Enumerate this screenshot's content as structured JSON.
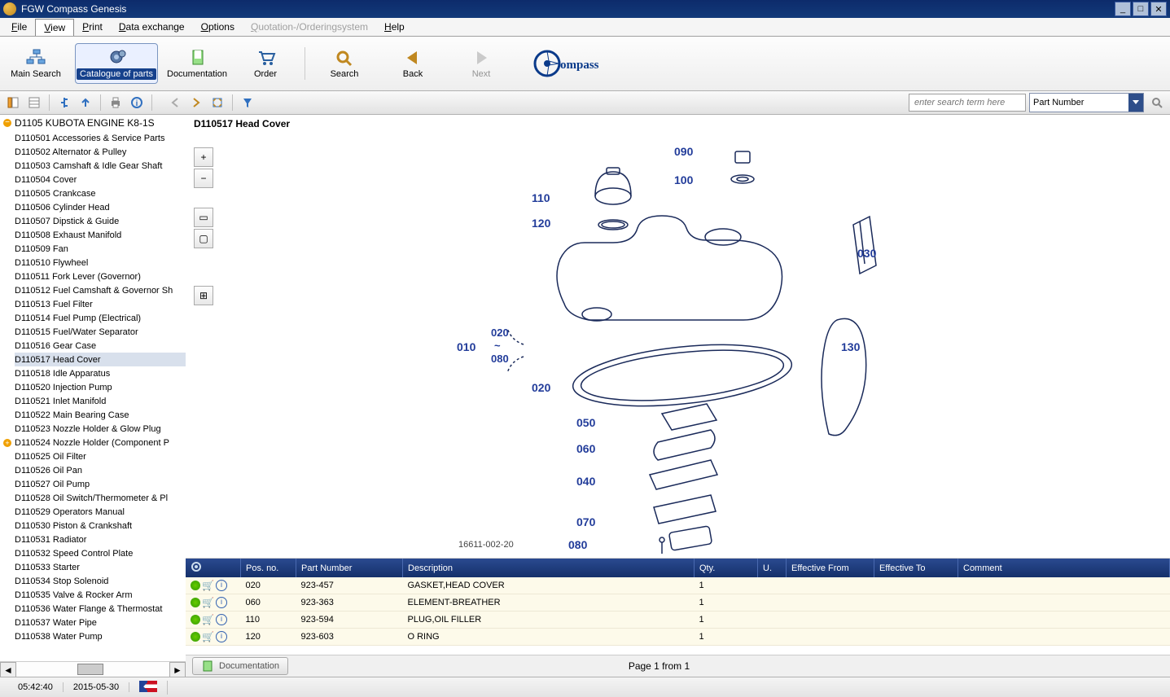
{
  "window": {
    "title": "FGW Compass Genesis"
  },
  "menubar": {
    "items": [
      {
        "label": "File",
        "disabled": false
      },
      {
        "label": "View",
        "disabled": false,
        "open": true
      },
      {
        "label": "Print",
        "disabled": false
      },
      {
        "label": "Data exchange",
        "disabled": false
      },
      {
        "label": "Options",
        "disabled": false
      },
      {
        "label": "Quotation-/Orderingsystem",
        "disabled": true
      },
      {
        "label": "Help",
        "disabled": false
      }
    ]
  },
  "toolbar": {
    "items": [
      {
        "name": "main-search",
        "label": "Main Search",
        "active": false,
        "disabled": false
      },
      {
        "name": "catalogue",
        "label": "Catalogue of parts",
        "active": true,
        "disabled": false
      },
      {
        "name": "documentation",
        "label": "Documentation",
        "active": false,
        "disabled": false
      },
      {
        "name": "order",
        "label": "Order",
        "active": false,
        "disabled": false
      },
      {
        "name": "search",
        "label": "Search",
        "active": false,
        "disabled": false
      },
      {
        "name": "back",
        "label": "Back",
        "active": false,
        "disabled": false
      },
      {
        "name": "next",
        "label": "Next",
        "active": false,
        "disabled": true
      }
    ],
    "logo_text": "Compass"
  },
  "search": {
    "placeholder": "enter search term here",
    "type_label": "Part Number"
  },
  "tree": {
    "root": "D1105 KUBOTA ENGINE K8-1S",
    "nodes": [
      {
        "label": "D110501 Accessories & Service Parts"
      },
      {
        "label": "D110502 Alternator & Pulley"
      },
      {
        "label": "D110503 Camshaft & Idle Gear Shaft"
      },
      {
        "label": "D110504 Cover"
      },
      {
        "label": "D110505 Crankcase"
      },
      {
        "label": "D110506 Cylinder Head"
      },
      {
        "label": "D110507 Dipstick & Guide"
      },
      {
        "label": "D110508 Exhaust Manifold"
      },
      {
        "label": "D110509 Fan"
      },
      {
        "label": "D110510 Flywheel"
      },
      {
        "label": "D110511 Fork Lever (Governor)"
      },
      {
        "label": "D110512 Fuel Camshaft & Governor Sh"
      },
      {
        "label": "D110513 Fuel Filter"
      },
      {
        "label": "D110514 Fuel Pump (Electrical)"
      },
      {
        "label": "D110515 Fuel/Water Separator"
      },
      {
        "label": "D110516 Gear Case"
      },
      {
        "label": "D110517 Head Cover",
        "selected": true
      },
      {
        "label": "D110518 Idle Apparatus"
      },
      {
        "label": "D110520 Injection Pump"
      },
      {
        "label": "D110521 Inlet Manifold"
      },
      {
        "label": "D110522 Main Bearing Case"
      },
      {
        "label": "D110523 Nozzle Holder & Glow Plug"
      },
      {
        "label": "D110524 Nozzle Holder (Component P",
        "expandable": true
      },
      {
        "label": "D110525 Oil Filter"
      },
      {
        "label": "D110526 Oil Pan"
      },
      {
        "label": "D110527 Oil Pump"
      },
      {
        "label": "D110528 Oil Switch/Thermometer & Pl"
      },
      {
        "label": "D110529 Operators Manual"
      },
      {
        "label": "D110530 Piston & Crankshaft"
      },
      {
        "label": "D110531 Radiator"
      },
      {
        "label": "D110532 Speed Control Plate"
      },
      {
        "label": "D110533 Starter"
      },
      {
        "label": "D110534 Stop Solenoid"
      },
      {
        "label": "D110535 Valve & Rocker Arm"
      },
      {
        "label": "D110536 Water Flange & Thermostat"
      },
      {
        "label": "D110537 Water Pipe"
      },
      {
        "label": "D110538 Water Pump"
      }
    ]
  },
  "main": {
    "title": "D110517 Head Cover",
    "callouts": {
      "010": "010",
      "020": "020",
      "020b": "020",
      "030": "030",
      "040": "040",
      "050": "050",
      "060": "060",
      "070": "070",
      "080": "080",
      "080b": "080",
      "090": "090",
      "100": "100",
      "110": "110",
      "120": "120",
      "130": "130"
    },
    "tilde": "~",
    "drawing_ref": "16611-002-20"
  },
  "tools": {
    "zoom_in": "+",
    "zoom_out": "−",
    "fit": "▭",
    "one": "▢",
    "split": "⊞"
  },
  "table": {
    "headers": [
      "",
      "Pos. no.",
      "Part Number",
      "Description",
      "Qty.",
      "U.",
      "Effective From",
      "Effective To",
      "Comment"
    ],
    "rows": [
      {
        "pos": "020",
        "pn": "923-457",
        "desc": "GASKET,HEAD COVER",
        "qty": "1"
      },
      {
        "pos": "060",
        "pn": "923-363",
        "desc": "ELEMENT-BREATHER",
        "qty": "1"
      },
      {
        "pos": "110",
        "pn": "923-594",
        "desc": "PLUG,OIL FILLER",
        "qty": "1"
      },
      {
        "pos": "120",
        "pn": "923-603",
        "desc": "O RING",
        "qty": "1"
      }
    ]
  },
  "footer": {
    "doc_btn": "Documentation",
    "pager": "Page 1 from 1"
  },
  "status": {
    "time": "05:42:40",
    "date": "2015-05-30"
  }
}
